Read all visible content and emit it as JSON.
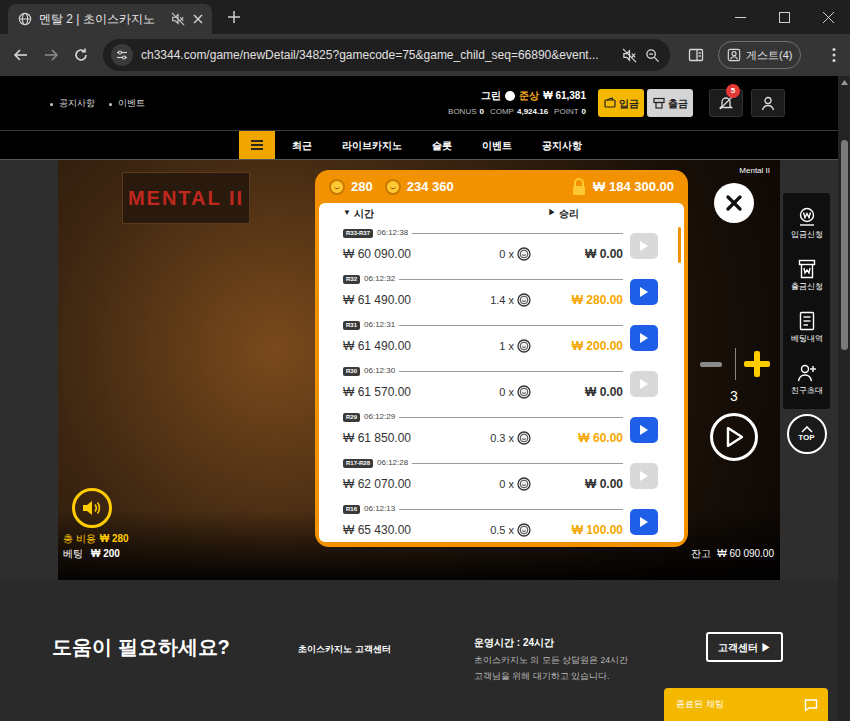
{
  "window": {
    "tab_title": "멘탈 2 | 초이스카지노",
    "tab_muted": true
  },
  "address_bar": {
    "url": "ch3344.com/game/newDetail/34825?gamecode=75&game_child_seq=66890&event...",
    "profile": "게스트(4)"
  },
  "site_header": {
    "links": [
      "공지사항",
      "이벤트"
    ],
    "user": {
      "level": "그린",
      "name": "준상",
      "balance": "₩ 61,381"
    },
    "stats": [
      {
        "label": "BONUS",
        "value": "0"
      },
      {
        "label": "COMP",
        "value": "4,924.16"
      },
      {
        "label": "POINT",
        "value": "0"
      }
    ],
    "deposit": "입금",
    "withdraw": "출금",
    "notifications": "5"
  },
  "nav": {
    "items": [
      "최근",
      "라이브카지노",
      "슬롯",
      "이벤트",
      "공지사항"
    ]
  },
  "game": {
    "title": "Mental II",
    "logo": "MENTAL II",
    "history": {
      "coins": "280",
      "total": "234 360",
      "locked": "₩ 184 300.00",
      "columns": [
        {
          "icon": "▼",
          "label": "시간"
        },
        {
          "icon": "▶",
          "label": "승리"
        }
      ],
      "rows": [
        {
          "badge": "R33-R37",
          "time": "06:12:38",
          "amount": "₩ 60 090.00",
          "multiplier": "0 x",
          "win": "₩ 0.00",
          "replay": false
        },
        {
          "badge": "R32",
          "time": "06:12:32",
          "amount": "₩ 61 490.00",
          "multiplier": "1.4 x",
          "win": "₩ 280.00",
          "replay": true
        },
        {
          "badge": "R31",
          "time": "06:12:31",
          "amount": "₩ 61 490.00",
          "multiplier": "1 x",
          "win": "₩ 200.00",
          "replay": true
        },
        {
          "badge": "R30",
          "time": "06:12:30",
          "amount": "₩ 61 570.00",
          "multiplier": "0 x",
          "win": "₩ 0.00",
          "replay": false
        },
        {
          "badge": "R29",
          "time": "06:12:29",
          "amount": "₩ 61 850.00",
          "multiplier": "0.3 x",
          "win": "₩ 60.00",
          "replay": true
        },
        {
          "badge": "R17-R28",
          "time": "06:12:28",
          "amount": "₩ 62 070.00",
          "multiplier": "0 x",
          "win": "₩ 0.00",
          "replay": false
        },
        {
          "badge": "R16",
          "time": "06:12:13",
          "amount": "₩ 65 430.00",
          "multiplier": "0.5 x",
          "win": "₩ 100.00",
          "replay": true
        }
      ]
    },
    "minus_enabled": false,
    "bet_level": "3",
    "total_cost_label": "총 비용",
    "total_cost": "₩ 280",
    "bet_label": "베팅",
    "bet": "₩ 200",
    "balance_label": "잔고",
    "balance": "₩ 60 090.00"
  },
  "side_menu": {
    "items": [
      "입금신청",
      "출금신청",
      "베팅내역",
      "친구초대"
    ],
    "top": "TOP"
  },
  "footer": {
    "title": "도움이 필요하세요?",
    "support_title": "초이스카지노 고객센터",
    "hours_title": "운영시간 : 24시간",
    "hours_lines": [
      "초이스카지노 의 모든 상담원은 24시간",
      "고객님을 위해 대기하고 있습니다."
    ],
    "support_button": "고객센터 ▶"
  },
  "chat": {
    "label": "종료된 채팅"
  }
}
